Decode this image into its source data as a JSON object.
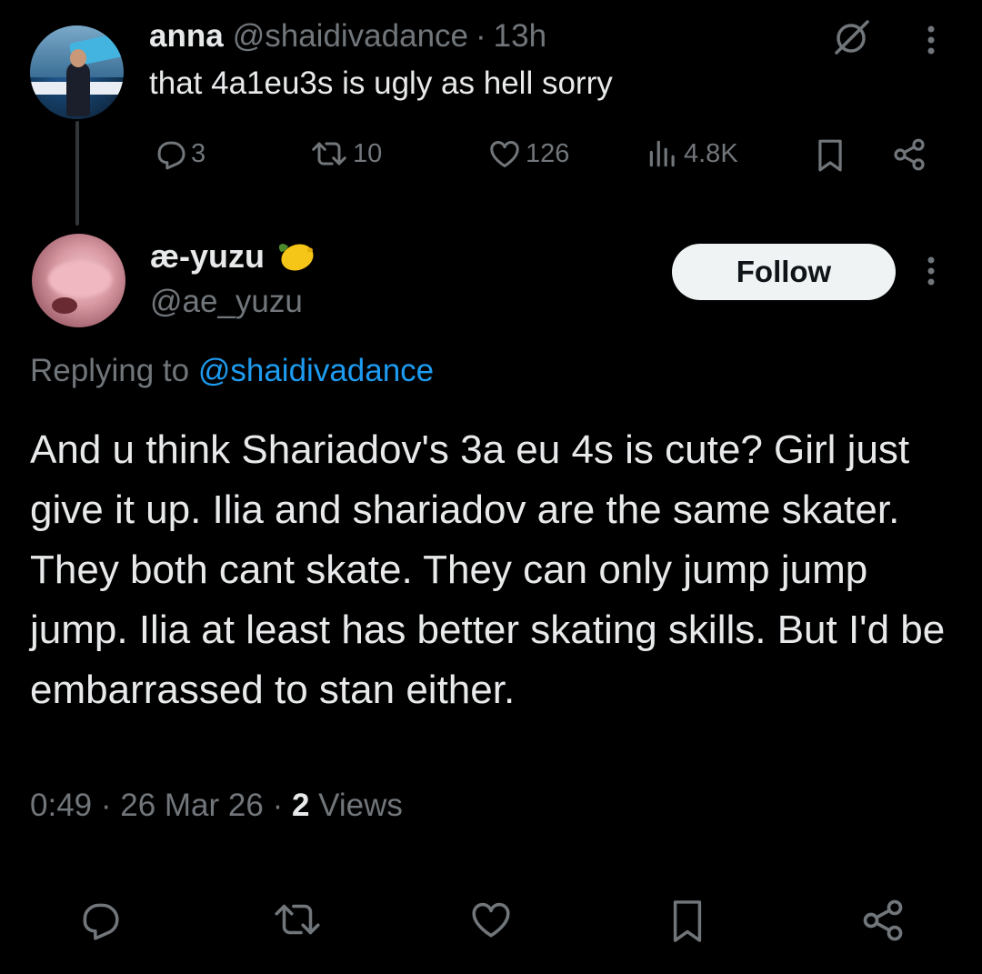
{
  "parent_tweet": {
    "name": "anna",
    "handle": "@shaidivadance",
    "separator": "·",
    "time": "13h",
    "text": "that 4a1eu3s is ugly as hell sorry",
    "stats": {
      "replies": "3",
      "reposts": "10",
      "likes": "126",
      "views": "4.8K"
    },
    "icons": {
      "grok": "grok-icon",
      "more": "more-vertical-icon",
      "reply": "reply-icon",
      "repost": "repost-icon",
      "like": "heart-icon",
      "views": "views-icon",
      "bookmark": "bookmark-icon",
      "share": "share-icon"
    }
  },
  "reply_tweet": {
    "name": "æ-yuzu",
    "name_emoji": "lemon-icon",
    "handle": "@ae_yuzu",
    "follow_label": "Follow",
    "replying_prefix": "Replying to",
    "replying_mention": "@shaidivadance",
    "text": "And u think Shariadov's 3a eu 4s is cute? Girl just give it up. Ilia and shariadov are the same skater. They both cant skate. They can only jump jump jump. Ilia at least has better skating skills. But I'd be embarrassed to stan either.",
    "time": "0:49",
    "date": "26 Mar 26",
    "separator": "·",
    "views_count": "2",
    "views_label": "Views"
  },
  "bottom_actions": [
    "reply-icon",
    "repost-icon",
    "heart-icon",
    "bookmark-icon",
    "share-icon"
  ],
  "colors": {
    "background": "#000000",
    "text_primary": "#e7e9ea",
    "text_secondary": "#71767b",
    "link": "#1d9bf0",
    "follow_bg": "#eff3f4",
    "lemon": "#f5c518"
  }
}
